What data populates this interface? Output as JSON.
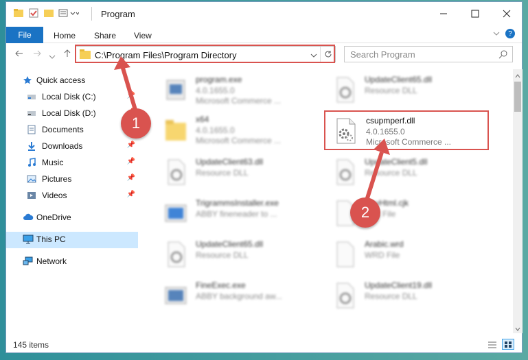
{
  "titlebar": {
    "title": "Program"
  },
  "ribbon": {
    "file": "File",
    "home": "Home",
    "share": "Share",
    "view": "View"
  },
  "address": {
    "path": "C:\\Program Files\\Program Directory"
  },
  "search": {
    "placeholder": "Search Program"
  },
  "sidebar": {
    "items": [
      {
        "label": "Quick access"
      },
      {
        "label": "Local Disk (C:)"
      },
      {
        "label": "Local Disk (D:)"
      },
      {
        "label": "Documents"
      },
      {
        "label": "Downloads"
      },
      {
        "label": "Music"
      },
      {
        "label": "Pictures"
      },
      {
        "label": "Videos"
      },
      {
        "label": "OneDrive"
      },
      {
        "label": "This PC"
      },
      {
        "label": "Network"
      }
    ]
  },
  "files": [
    {
      "name": "program.exe",
      "line1": "4.0.1655.0",
      "line2": "Microsoft Commerce ..."
    },
    {
      "name": "UpdateClient65.dll",
      "line1": "Resource DLL",
      "line2": ""
    },
    {
      "name": "x64",
      "line1": "4.0.1655.0",
      "line2": "Microsoft Commerce ..."
    },
    {
      "name": "csupmperf.dll",
      "line1": "4.0.1655.0",
      "line2": "Microsoft Commerce ..."
    },
    {
      "name": "UpdateClient63.dll",
      "line1": "Resource DLL",
      "line2": ""
    },
    {
      "name": "UpdateClient5.dll",
      "line1": "Resource DLL",
      "line2": ""
    },
    {
      "name": "TrigrammsInstaller.exe",
      "line1": "ABBY fineneader to ...",
      "line2": ""
    },
    {
      "name": "DevHtml.cjk",
      "line1": "CJK File",
      "line2": ""
    },
    {
      "name": "UpdateClient65.dll",
      "line1": "Resource DLL",
      "line2": ""
    },
    {
      "name": "Arabic.wrd",
      "line1": "WRD File",
      "line2": ""
    },
    {
      "name": "FineExec.exe",
      "line1": "ABBY background aw...",
      "line2": ""
    },
    {
      "name": "UpdateClient19.dll",
      "line1": "Resource DLL",
      "line2": ""
    }
  ],
  "status": {
    "count": "145 items"
  },
  "annotations": {
    "step1": "1",
    "step2": "2"
  },
  "colors": {
    "accent": "#1a73c4",
    "highlight": "#d9534f",
    "selected": "#cce8ff"
  }
}
